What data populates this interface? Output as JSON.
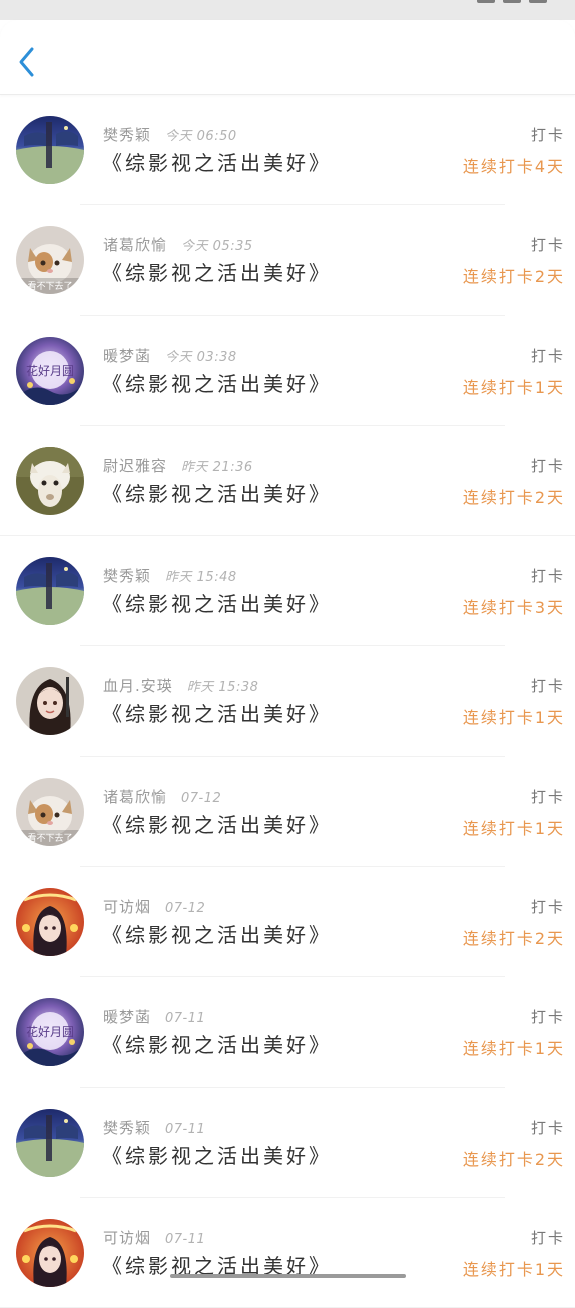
{
  "entries": [
    {
      "user": "樊秀颖",
      "time": "今天 06:50",
      "book": "《综影视之活出美好》",
      "checkin": "打卡",
      "streak": "连续打卡4天",
      "avatar": "night-landscape"
    },
    {
      "user": "诸葛欣愉",
      "time": "今天 05:35",
      "book": "《综影视之活出美好》",
      "checkin": "打卡",
      "streak": "连续打卡2天",
      "avatar": "cat",
      "avatar_caption": "看不下去了"
    },
    {
      "user": "暖梦菡",
      "time": "今天 03:38",
      "book": "《综影视之活出美好》",
      "checkin": "打卡",
      "streak": "连续打卡1天",
      "avatar": "moon-flower",
      "avatar_caption": "花好月圆"
    },
    {
      "user": "尉迟雅容",
      "time": "昨天 21:36",
      "book": "《综影视之活出美好》",
      "checkin": "打卡",
      "streak": "连续打卡2天",
      "avatar": "alpaca"
    },
    {
      "user": "樊秀颖",
      "time": "昨天 15:48",
      "book": "《综影视之活出美好》",
      "checkin": "打卡",
      "streak": "连续打卡3天",
      "avatar": "night-landscape"
    },
    {
      "user": "血月.安瑛",
      "time": "昨天 15:38",
      "book": "《综影视之活出美好》",
      "checkin": "打卡",
      "streak": "连续打卡1天",
      "avatar": "girl-portrait"
    },
    {
      "user": "诸葛欣愉",
      "time": "07-12",
      "book": "《综影视之活出美好》",
      "checkin": "打卡",
      "streak": "连续打卡1天",
      "avatar": "cat",
      "avatar_caption": "看不下去了"
    },
    {
      "user": "可访烟",
      "time": "07-12",
      "book": "《综影视之活出美好》",
      "checkin": "打卡",
      "streak": "连续打卡2天",
      "avatar": "red-portrait"
    },
    {
      "user": "暖梦菡",
      "time": "07-11",
      "book": "《综影视之活出美好》",
      "checkin": "打卡",
      "streak": "连续打卡1天",
      "avatar": "moon-flower",
      "avatar_caption": "花好月圆"
    },
    {
      "user": "樊秀颖",
      "time": "07-11",
      "book": "《综影视之活出美好》",
      "checkin": "打卡",
      "streak": "连续打卡2天",
      "avatar": "night-landscape"
    },
    {
      "user": "可访烟",
      "time": "07-11",
      "book": "《综影视之活出美好》",
      "checkin": "打卡",
      "streak": "连续打卡1天",
      "avatar": "red-portrait"
    }
  ],
  "colors": {
    "accent_back": "#2d8fd8",
    "streak": "#e8974f",
    "name": "#9a9a9a",
    "title": "#333333"
  },
  "icons": {
    "back": "chevron-left-icon"
  }
}
